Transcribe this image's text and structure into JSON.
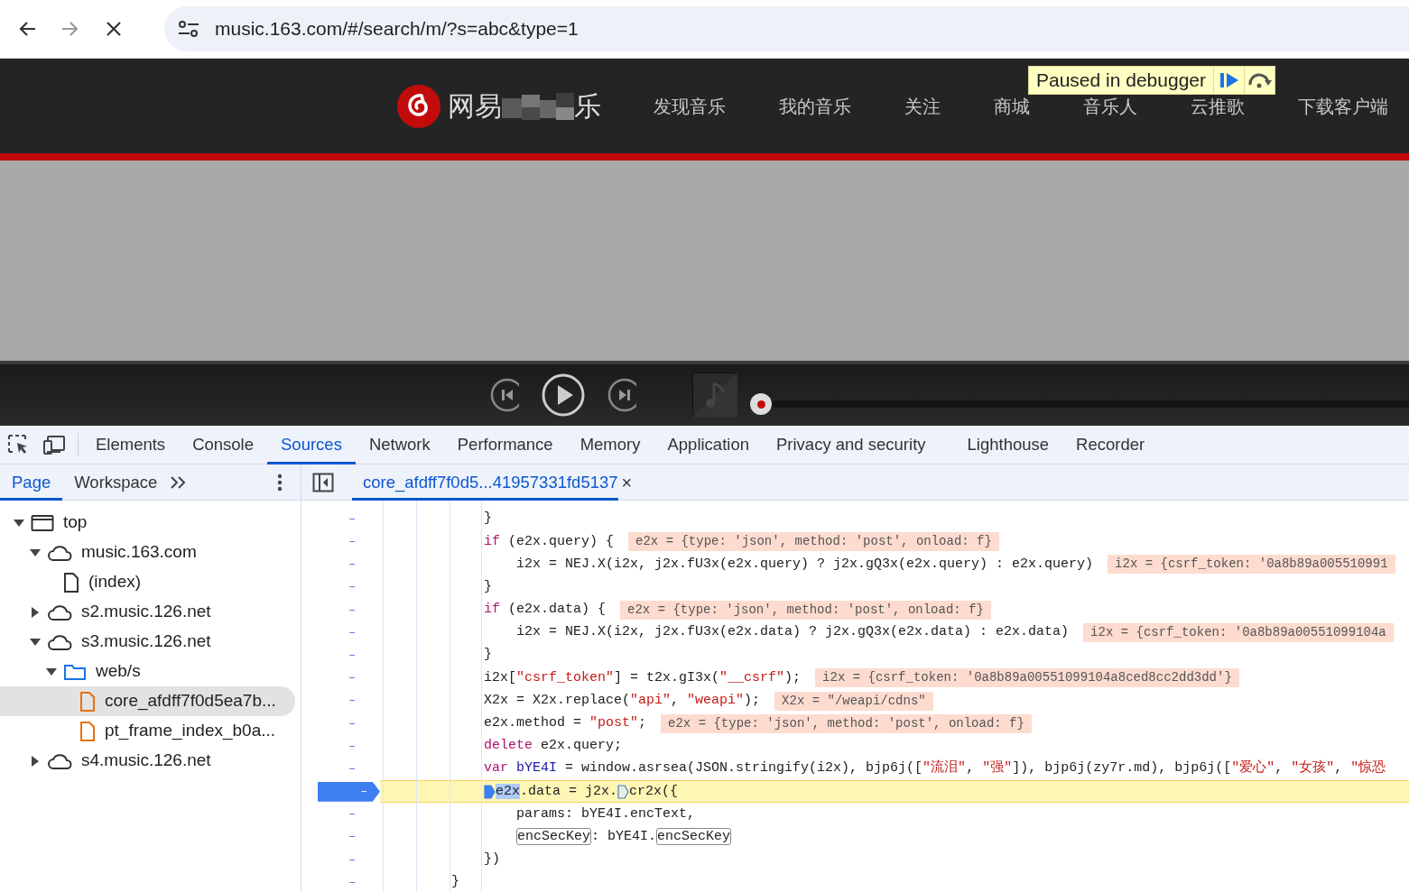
{
  "browser": {
    "url": "music.163.com/#/search/m/?s=abc&type=1",
    "loading": true
  },
  "site": {
    "logo_text_start": "网易",
    "logo_text_end": "乐",
    "nav": [
      {
        "label": "发现音乐"
      },
      {
        "label": "我的音乐"
      },
      {
        "label": "关注"
      },
      {
        "label": "商城"
      },
      {
        "label": "音乐人"
      },
      {
        "label": "云推歌"
      },
      {
        "label": "下载客户端"
      }
    ]
  },
  "debugger_overlay": {
    "label": "Paused in debugger"
  },
  "player": {
    "playing": false
  },
  "devtools": {
    "tabs": [
      {
        "label": "Elements",
        "selected": false
      },
      {
        "label": "Console",
        "selected": false
      },
      {
        "label": "Sources",
        "selected": true
      },
      {
        "label": "Network",
        "selected": false
      },
      {
        "label": "Performance",
        "selected": false
      },
      {
        "label": "Memory",
        "selected": false
      },
      {
        "label": "Application",
        "selected": false
      },
      {
        "label": "Privacy and security",
        "selected": false
      },
      {
        "label": "Lighthouse",
        "selected": false
      },
      {
        "label": "Recorder",
        "selected": false
      }
    ],
    "navigator_tabs": [
      {
        "label": "Page",
        "selected": true
      },
      {
        "label": "Workspace",
        "selected": false
      }
    ],
    "editor_tab": {
      "label": "core_afdff7f0d5...41957331fd5137",
      "close": "×"
    },
    "tree": [
      {
        "label": "top",
        "kind": "frame",
        "expanded": true,
        "selected": false,
        "children": [
          {
            "label": "music.163.com",
            "kind": "domain",
            "expanded": true,
            "selected": false,
            "children": [
              {
                "label": "(index)",
                "kind": "file",
                "selected": false
              }
            ]
          },
          {
            "label": "s2.music.126.net",
            "kind": "domain",
            "expanded": false,
            "selected": false
          },
          {
            "label": "s3.music.126.net",
            "kind": "domain",
            "expanded": true,
            "selected": false,
            "children": [
              {
                "label": "web/s",
                "kind": "folder",
                "expanded": true,
                "selected": false,
                "children": [
                  {
                    "label": "core_afdff7f0d5ea7b...",
                    "kind": "script",
                    "selected": true
                  },
                  {
                    "label": "pt_frame_index_b0a...",
                    "kind": "script",
                    "selected": false
                  }
                ]
              }
            ]
          },
          {
            "label": "s4.music.126.net",
            "kind": "domain",
            "expanded": false,
            "selected": false
          }
        ]
      }
    ],
    "code": {
      "lines": [
        {
          "gutter": "–",
          "paused": false,
          "segments": [
            {
              "kind": "plain",
              "text": "}"
            }
          ]
        },
        {
          "gutter": "–",
          "paused": false,
          "segments": [
            {
              "kind": "keyword",
              "text": "if"
            },
            {
              "kind": "plain",
              "text": " (e2x.query) {"
            }
          ],
          "value": "e2x = {type: 'json', method: 'post', onload: f}",
          "children": [
            {
              "gutter": "–",
              "paused": false,
              "segments": [
                {
                  "kind": "plain",
                  "text": "i2x = NEJ.X(i2x, j2x.fU3x(e2x.query) ? j2x.gQ3x(e2x.query) : e2x.query)"
                }
              ],
              "value": "i2x = {csrf_token: '0a8b89a005510991"
            }
          ]
        },
        {
          "gutter": "–",
          "paused": false,
          "segments": [
            {
              "kind": "plain",
              "text": "}"
            }
          ]
        },
        {
          "gutter": "–",
          "paused": false,
          "segments": [
            {
              "kind": "keyword",
              "text": "if"
            },
            {
              "kind": "plain",
              "text": " (e2x.data) {"
            }
          ],
          "value": "e2x = {type: 'json', method: 'post', onload: f}",
          "children": [
            {
              "gutter": "–",
              "paused": false,
              "segments": [
                {
                  "kind": "plain",
                  "text": "i2x = NEJ.X(i2x, j2x.fU3x(e2x.data) ? j2x.gQ3x(e2x.data) : e2x.data)"
                }
              ],
              "value": "i2x = {csrf_token: '0a8b89a00551099104a"
            }
          ]
        },
        {
          "gutter": "–",
          "paused": false,
          "segments": [
            {
              "kind": "plain",
              "text": "}"
            }
          ]
        },
        {
          "gutter": "–",
          "paused": false,
          "segments": [
            {
              "kind": "plain",
              "text": "i2x["
            },
            {
              "kind": "string",
              "text": "\"csrf_token\""
            },
            {
              "kind": "plain",
              "text": "] = t2x.gI3x("
            },
            {
              "kind": "string",
              "text": "\"__csrf\""
            },
            {
              "kind": "plain",
              "text": ");"
            }
          ],
          "value": "i2x = {csrf_token: '0a8b89a00551099104a8ced8cc2dd3dd'}"
        },
        {
          "gutter": "–",
          "paused": false,
          "segments": [
            {
              "kind": "plain",
              "text": "X2x = X2x.replace("
            },
            {
              "kind": "string",
              "text": "\"api\""
            },
            {
              "kind": "plain",
              "text": ", "
            },
            {
              "kind": "string",
              "text": "\"weapi\""
            },
            {
              "kind": "plain",
              "text": ");"
            }
          ],
          "value": "X2x = \"/weapi/cdns\""
        },
        {
          "gutter": "–",
          "paused": false,
          "segments": [
            {
              "kind": "plain",
              "text": "e2x.method = "
            },
            {
              "kind": "string",
              "text": "\"post\""
            },
            {
              "kind": "plain",
              "text": ";"
            }
          ],
          "value": "e2x = {type: 'json', method: 'post', onload: f}"
        },
        {
          "gutter": "–",
          "paused": false,
          "segments": [
            {
              "kind": "keyword",
              "text": "delete"
            },
            {
              "kind": "plain",
              "text": " e2x.query;"
            }
          ]
        },
        {
          "gutter": "–",
          "paused": false,
          "segments": [
            {
              "kind": "keyword",
              "text": "var"
            },
            {
              "kind": "def",
              "text": " bYE4I"
            },
            {
              "kind": "plain",
              "text": " = window.asrsea(JSON.stringify(i2x), bjp6j(["
            },
            {
              "kind": "string",
              "text": "\"流泪\""
            },
            {
              "kind": "plain",
              "text": ", "
            },
            {
              "kind": "string",
              "text": "\"强\""
            },
            {
              "kind": "plain",
              "text": "]), bjp6j(zy7r.md), bjp6j(["
            },
            {
              "kind": "string",
              "text": "\"爱心\""
            },
            {
              "kind": "plain",
              "text": ", "
            },
            {
              "kind": "string",
              "text": "\"女孩\""
            },
            {
              "kind": "plain",
              "text": ", "
            },
            {
              "kind": "string",
              "text": "\"惊恐"
            }
          ]
        },
        {
          "gutter": "–",
          "paused": true,
          "segments": [
            {
              "kind": "step",
              "active": true
            },
            {
              "kind": "selected",
              "text": "e2x"
            },
            {
              "kind": "plain",
              "text": ".data = j2x."
            },
            {
              "kind": "step",
              "active": false
            },
            {
              "kind": "plain",
              "text": "cr2x({"
            }
          ],
          "children": [
            {
              "gutter": "–",
              "paused": false,
              "segments": [
                {
                  "kind": "plain",
                  "text": "params: bYE4I.encText,"
                }
              ]
            },
            {
              "gutter": "–",
              "paused": false,
              "segments": [
                {
                  "kind": "boxed",
                  "text": "encSecKey"
                },
                {
                  "kind": "plain",
                  "text": ": bYE4I."
                },
                {
                  "kind": "boxed",
                  "text": "encSecKey"
                }
              ]
            }
          ]
        },
        {
          "gutter": "–",
          "paused": false,
          "segments": [
            {
              "kind": "plain",
              "text": "})"
            }
          ]
        }
      ],
      "outer_close": {
        "gutter": "–",
        "text": "}"
      }
    }
  }
}
